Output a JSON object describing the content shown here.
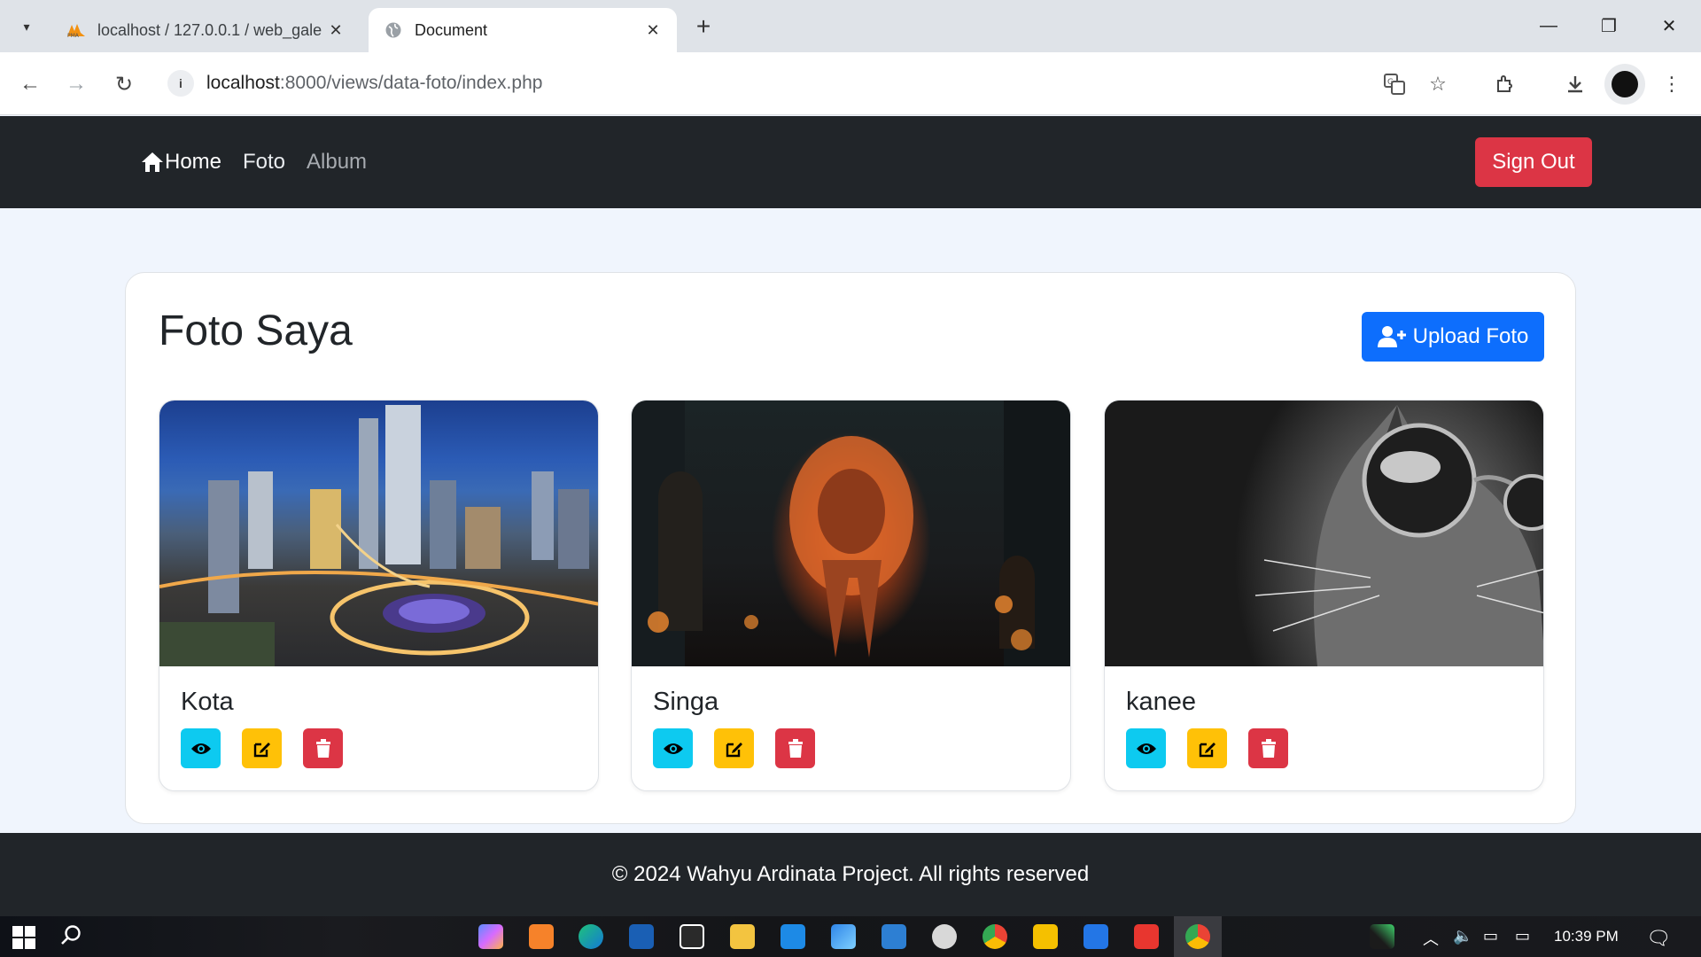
{
  "browser": {
    "tabs": [
      {
        "title": "localhost / 127.0.0.1 / web_gale",
        "icon": "phpmyadmin-icon",
        "active": false
      },
      {
        "title": "Document",
        "icon": "globe-icon",
        "active": true
      }
    ],
    "new_tab_label": "+",
    "url_host": "localhost",
    "url_rest": ":8000/views/data-foto/index.php"
  },
  "navbar": {
    "home_label": "Home",
    "links": [
      "Foto",
      "Album"
    ],
    "signout_label": "Sign Out"
  },
  "page": {
    "title": "Foto Saya",
    "upload_label": "Upload Foto",
    "photos": [
      {
        "name": "Kota",
        "image": "city-night-aerial"
      },
      {
        "name": "Singa",
        "image": "fire-lion"
      },
      {
        "name": "kanee",
        "image": "cat-with-sunglasses"
      }
    ]
  },
  "footer": {
    "text": "© 2024 Wahyu Ardinata Project. All rights reserved"
  },
  "taskbar": {
    "time": "10:39 PM"
  },
  "colors": {
    "navbar_bg": "#212529",
    "danger": "#dc3545",
    "primary": "#0d6efd",
    "info": "#0dcaf0",
    "warning": "#ffc107",
    "page_bg": "#f0f5fd"
  }
}
